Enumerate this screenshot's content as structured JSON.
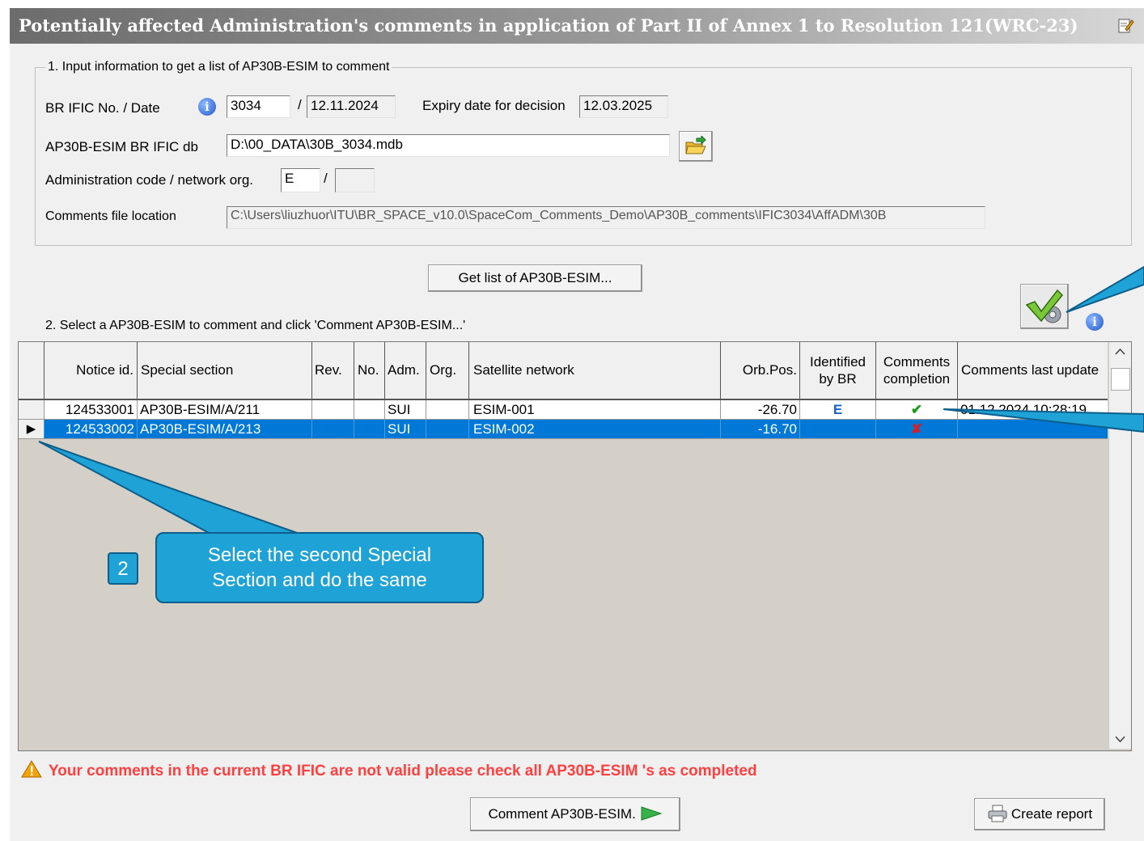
{
  "window": {
    "title": "Potentially affected Administration's comments in application of Part II of Annex 1 to Resolution 121(WRC-23)"
  },
  "section1": {
    "legend": "1. Input information to get a list of AP30B-ESIM to comment",
    "br_ific_label": "BR IFIC No. / Date",
    "br_ific_no": "3034",
    "slash": "/",
    "br_ific_date": "12.11.2024",
    "expiry_label": "Expiry date for decision",
    "expiry_date": "12.03.2025",
    "db_label": "AP30B-ESIM BR IFIC db",
    "db_path": "D:\\00_DATA\\30B_3034.mdb",
    "adm_label": "Administration code / network org.",
    "adm_code": "E",
    "network_org": "",
    "comments_file_label": "Comments file location",
    "comments_file_path": "C:\\Users\\liuzhuor\\ITU\\BR_SPACE_v10.0\\SpaceCom_Comments_Demo\\AP30B_comments\\IFIC3034\\AffADM\\30B"
  },
  "get_list_button": "Get list of AP30B-ESIM...",
  "section2": {
    "label": "2. Select a AP30B-ESIM to comment and click 'Comment AP30B-ESIM...'"
  },
  "table": {
    "headers": {
      "notice_id": "Notice id.",
      "special_section": "Special section",
      "rev": "Rev.",
      "no": "No.",
      "adm": "Adm.",
      "org": "Org.",
      "satellite_network": "Satellite network",
      "orb_pos": "Orb.Pos.",
      "identified_1": "Identified",
      "identified_2": "by BR",
      "comments_1": "Comments",
      "comments_2": "completion",
      "last_update": "Comments last update"
    },
    "rows": [
      {
        "notice_id": "124533001",
        "special_section": "AP30B-ESIM/A/211",
        "rev": "",
        "no": "",
        "adm": "SUI",
        "org": "",
        "satellite_network": "ESIM-001",
        "orb_pos": "-26.70",
        "identified": "E",
        "completion": "✔",
        "last_update": "01.12.2024 10:28:19"
      },
      {
        "notice_id": "124533002",
        "special_section": "AP30B-ESIM/A/213",
        "rev": "",
        "no": "",
        "adm": "SUI",
        "org": "",
        "satellite_network": "ESIM-002",
        "orb_pos": "-16.70",
        "identified": "",
        "completion": "✘",
        "last_update": ""
      }
    ],
    "selected_row_marker": "▶"
  },
  "warning": {
    "icon": "warning-triangle-icon",
    "text": "Your comments in the current BR IFIC are not valid please check all AP30B-ESIM 's as completed"
  },
  "comment_button": "Comment AP30B-ESIM.",
  "create_report_button": "Create report",
  "annotation": {
    "step": "2",
    "text_line1": "Select the second Special",
    "text_line2": "Section and do the same"
  },
  "colors": {
    "selection": "#0078d7",
    "callout": "#1fa2d6",
    "warning_text": "#ff4040",
    "check_green": "#1a9a1a",
    "cross_red": "#d81e1e",
    "identified_blue": "#1a5fd0"
  }
}
